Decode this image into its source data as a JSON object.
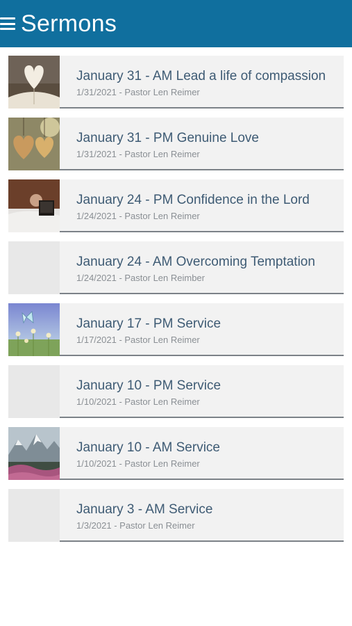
{
  "header": {
    "title": "Sermons",
    "menu_icon": "hamburger-menu-icon",
    "bg": "#106f9e"
  },
  "sermons": [
    {
      "title": "January 31 - AM Lead a life of compassion",
      "subtitle": "1/31/2021 - Pastor Len Reimer",
      "thumb": "open-book-heart"
    },
    {
      "title": "January 31 - PM Genuine Love",
      "subtitle": "1/31/2021 - Pastor Len Reimer",
      "thumb": "paper-hearts"
    },
    {
      "title": "January 24 - PM Confidence in the Lord",
      "subtitle": "1/24/2021 - Pastor Len Reimer",
      "thumb": "reading-bible"
    },
    {
      "title": "January 24 - AM Overcoming Temptation",
      "subtitle": "1/24/2021 - Pastor Len Reimber",
      "thumb": "none"
    },
    {
      "title": "January 17 - PM Service",
      "subtitle": "1/17/2021 - Pastor Len Reimer",
      "thumb": "butterfly-flowers"
    },
    {
      "title": "January 10 - PM Service",
      "subtitle": "1/10/2021 - Pastor Len Reimer",
      "thumb": "none"
    },
    {
      "title": "January 10 - AM Service",
      "subtitle": "1/10/2021 - Pastor Len Reimer",
      "thumb": "mountain-flowers"
    },
    {
      "title": "January 3 - AM Service",
      "subtitle": "1/3/2021 - Pastor Len Reimer",
      "thumb": "none"
    }
  ]
}
